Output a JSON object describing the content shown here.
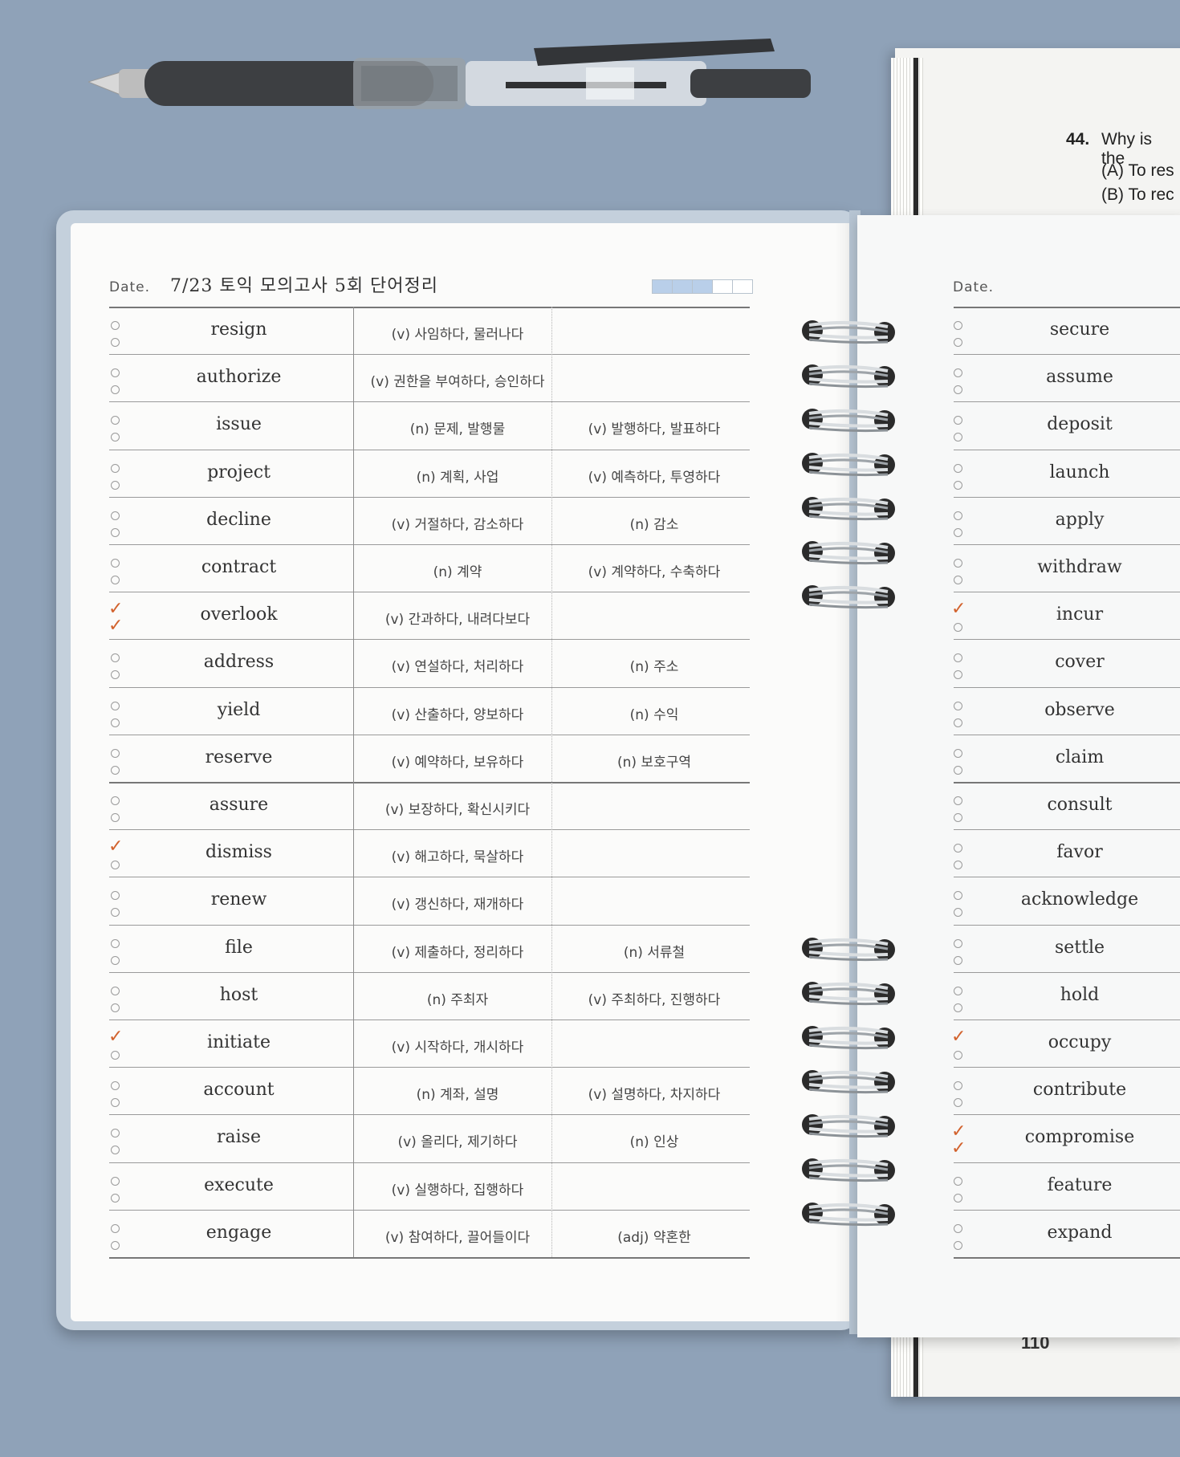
{
  "textbook": {
    "question_number": "44.",
    "question_text": "Why is the",
    "option_a": "(A) To res",
    "option_b": "(B) To rec",
    "page_number": "110"
  },
  "left_page": {
    "date_label": "Date.",
    "title": "7/23 토익 모의고사 5회 단어정리",
    "progress_boxes_filled": 3,
    "progress_boxes_total": 5,
    "rows": [
      {
        "word": "resign",
        "meaning1": "(v) 사임하다, 물러나다",
        "meaning2": "",
        "checks": 0
      },
      {
        "word": "authorize",
        "meaning1": "(v) 권한을 부여하다, 승인하다",
        "meaning2": "",
        "checks": 0
      },
      {
        "word": "issue",
        "meaning1": "(n) 문제, 발행물",
        "meaning2": "(v) 발행하다, 발표하다",
        "checks": 0
      },
      {
        "word": "project",
        "meaning1": "(n) 계획, 사업",
        "meaning2": "(v) 예측하다, 투영하다",
        "checks": 0
      },
      {
        "word": "decline",
        "meaning1": "(v) 거절하다, 감소하다",
        "meaning2": "(n) 감소",
        "checks": 0
      },
      {
        "word": "contract",
        "meaning1": "(n) 계약",
        "meaning2": "(v) 계약하다, 수축하다",
        "checks": 0
      },
      {
        "word": "overlook",
        "meaning1": "(v) 간과하다, 내려다보다",
        "meaning2": "",
        "checks": 2
      },
      {
        "word": "address",
        "meaning1": "(v) 연설하다, 처리하다",
        "meaning2": "(n) 주소",
        "checks": 0
      },
      {
        "word": "yield",
        "meaning1": "(v) 산출하다, 양보하다",
        "meaning2": "(n) 수익",
        "checks": 0
      },
      {
        "word": "reserve",
        "meaning1": "(v) 예약하다, 보유하다",
        "meaning2": "(n) 보호구역",
        "checks": 0
      },
      {
        "word": "assure",
        "meaning1": "(v) 보장하다, 확신시키다",
        "meaning2": "",
        "checks": 0
      },
      {
        "word": "dismiss",
        "meaning1": "(v) 해고하다, 묵살하다",
        "meaning2": "",
        "checks": 1
      },
      {
        "word": "renew",
        "meaning1": "(v) 갱신하다, 재개하다",
        "meaning2": "",
        "checks": 0
      },
      {
        "word": "file",
        "meaning1": "(v) 제출하다, 정리하다",
        "meaning2": "(n) 서류철",
        "checks": 0
      },
      {
        "word": "host",
        "meaning1": "(n) 주최자",
        "meaning2": "(v) 주최하다, 진행하다",
        "checks": 0
      },
      {
        "word": "initiate",
        "meaning1": "(v) 시작하다, 개시하다",
        "meaning2": "",
        "checks": 1
      },
      {
        "word": "account",
        "meaning1": "(n) 계좌, 설명",
        "meaning2": "(v) 설명하다, 차지하다",
        "checks": 0
      },
      {
        "word": "raise",
        "meaning1": "(v) 올리다, 제기하다",
        "meaning2": "(n) 인상",
        "checks": 0
      },
      {
        "word": "execute",
        "meaning1": "(v) 실행하다, 집행하다",
        "meaning2": "",
        "checks": 0
      },
      {
        "word": "engage",
        "meaning1": "(v) 참여하다, 끌어들이다",
        "meaning2": "(adj) 약혼한",
        "checks": 0
      }
    ]
  },
  "right_page": {
    "date_label": "Date.",
    "rows": [
      {
        "word": "secure",
        "checks": 0
      },
      {
        "word": "assume",
        "checks": 0
      },
      {
        "word": "deposit",
        "checks": 0
      },
      {
        "word": "launch",
        "checks": 0
      },
      {
        "word": "apply",
        "checks": 0
      },
      {
        "word": "withdraw",
        "checks": 0
      },
      {
        "word": "incur",
        "checks": 1
      },
      {
        "word": "cover",
        "checks": 0
      },
      {
        "word": "observe",
        "checks": 0
      },
      {
        "word": "claim",
        "checks": 0
      },
      {
        "word": "consult",
        "checks": 0
      },
      {
        "word": "favor",
        "checks": 0
      },
      {
        "word": "acknowledge",
        "checks": 0
      },
      {
        "word": "settle",
        "checks": 0
      },
      {
        "word": "hold",
        "checks": 0
      },
      {
        "word": "occupy",
        "checks": 1
      },
      {
        "word": "contribute",
        "checks": 0
      },
      {
        "word": "compromise",
        "checks": 2
      },
      {
        "word": "feature",
        "checks": 0
      },
      {
        "word": "expand",
        "checks": 0
      }
    ]
  },
  "colors": {
    "background": "#8fa2b8",
    "check_mark": "#d2622d",
    "progress_fill": "#b9cfe9"
  }
}
